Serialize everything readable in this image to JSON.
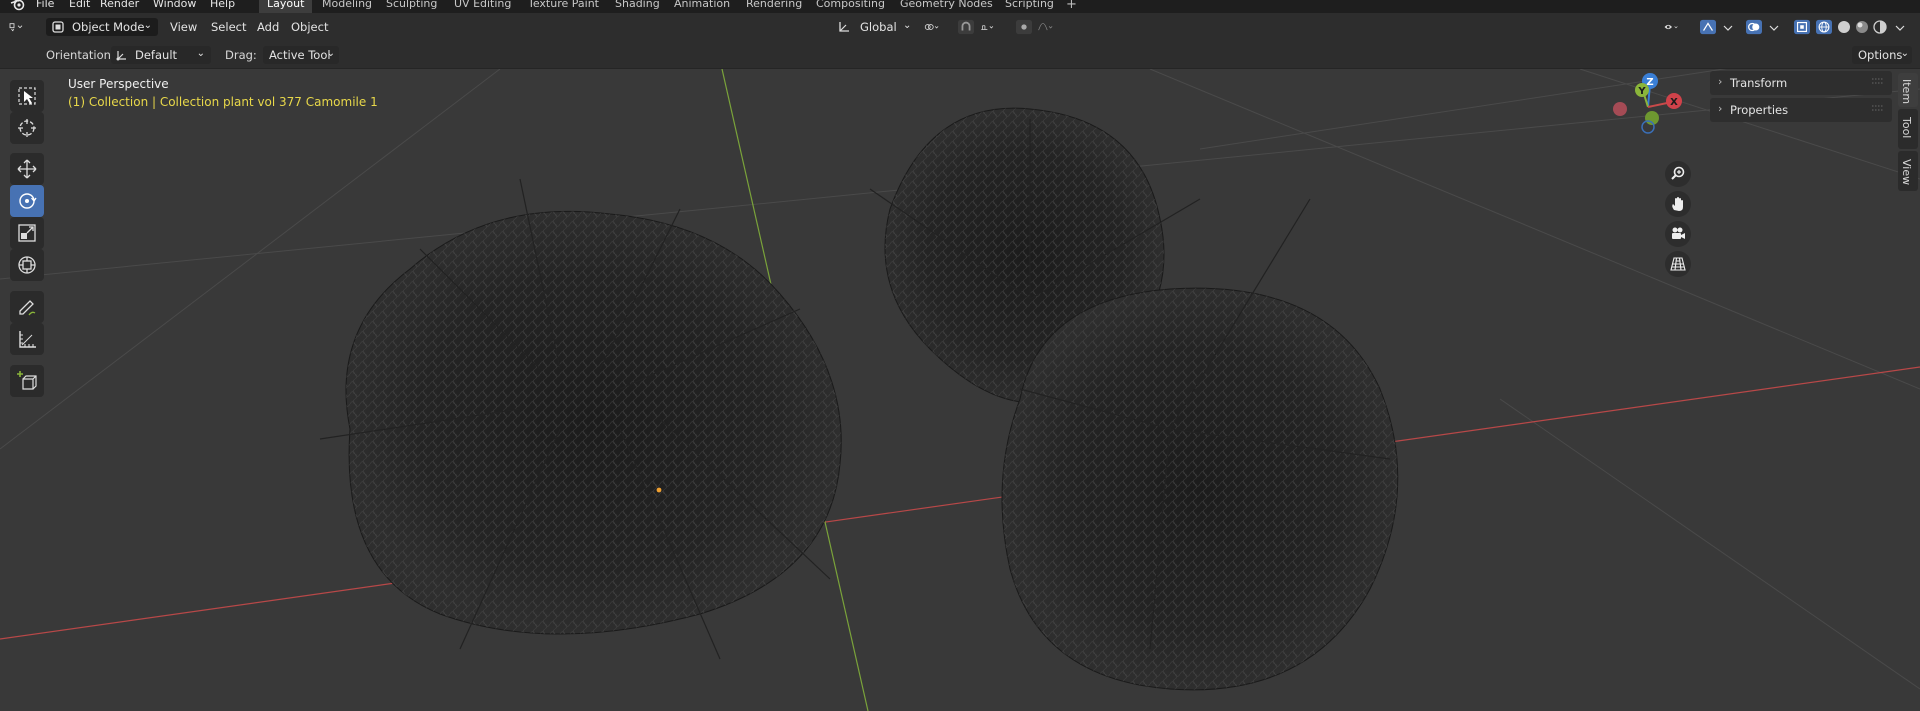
{
  "topbar": {
    "menus": [
      "File",
      "Edit",
      "Render",
      "Window",
      "Help"
    ],
    "workspaces": [
      "Layout",
      "Modeling",
      "Sculpting",
      "UV Editing",
      "Texture Paint",
      "Shading",
      "Animation",
      "Rendering",
      "Compositing",
      "Geometry Nodes",
      "Scripting"
    ],
    "active_workspace": "Layout",
    "add_tab": "+"
  },
  "header": {
    "mode": "Object Mode",
    "menus": [
      "View",
      "Select",
      "Add",
      "Object"
    ],
    "transform_orientation": "Global"
  },
  "toolsettings": {
    "orientation_label": "Orientation:",
    "orientation_value": "Default",
    "drag_label": "Drag:",
    "drag_value": "Active Tool",
    "options": "Options"
  },
  "viewport": {
    "view_name": "User Perspective",
    "collection_info": "(1) Collection | Collection plant vol 377 Camomile 1",
    "gizmo_axes": [
      "Z",
      "Y",
      "X"
    ]
  },
  "toolbar": {
    "tools": [
      "select-box",
      "cursor",
      "move",
      "rotate",
      "scale",
      "transform",
      "annotate",
      "measure",
      "add-cube"
    ],
    "active_tool": "rotate"
  },
  "npanel": {
    "sections": [
      "Transform",
      "Properties"
    ],
    "tabs": [
      "Item",
      "Tool",
      "View"
    ]
  },
  "colors": {
    "x_axis": "#c84a4a",
    "y_axis": "#8ab53a",
    "z_axis": "#3a7fd6",
    "active_accent": "#4772b3",
    "collection_text": "#e8d84a"
  }
}
